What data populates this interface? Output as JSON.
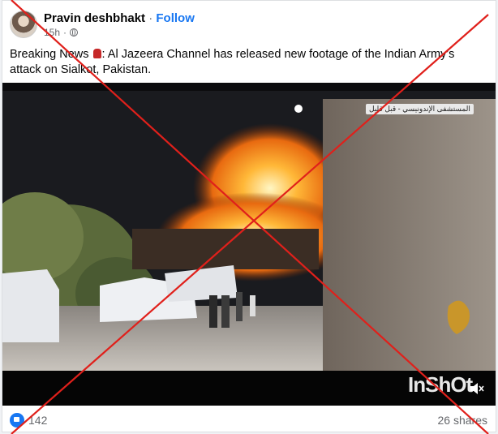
{
  "post": {
    "author": "Pravin deshbhakt",
    "separator": "·",
    "follow_label": "Follow",
    "time": "15h",
    "visibility_icon": "globe-icon",
    "text_before": "Breaking News ",
    "text_after": ": Al Jazeera Channel has released new footage of the Indian Army's attack on Sialkot, Pakistan."
  },
  "video": {
    "overlay_tag": "المستشفى الإندونيسي - قبل قليل",
    "watermark": "InShOt",
    "sound_icon": "speaker-muted-icon",
    "channel_logo": "al-jazeera-logo-icon"
  },
  "stats": {
    "reaction_icon": "like-icon",
    "reactions_count": "142",
    "shares": "26 shares"
  },
  "colors": {
    "accent": "#1877f2",
    "cross": "#e0201b"
  }
}
